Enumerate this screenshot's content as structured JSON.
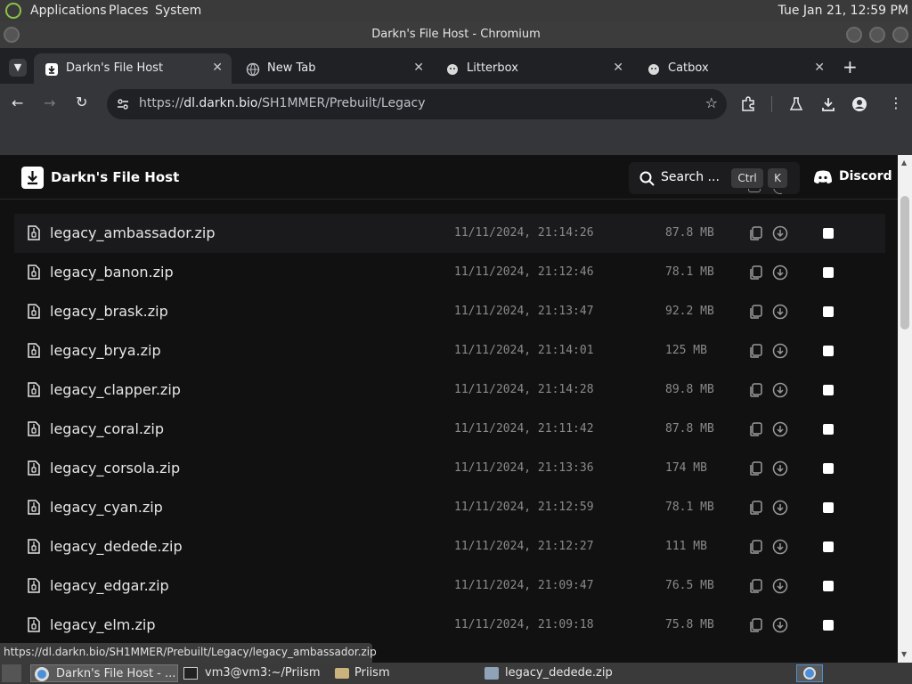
{
  "system_panel": {
    "menus": [
      "Applications",
      "Places",
      "System"
    ],
    "clock": "Tue Jan 21, 12:59 PM"
  },
  "window": {
    "title": "Darkn's File Host - Chromium"
  },
  "tabs": [
    {
      "label": "Darkn's File Host",
      "active": true
    },
    {
      "label": "New Tab",
      "active": false
    },
    {
      "label": "Litterbox",
      "active": false
    },
    {
      "label": "Catbox",
      "active": false
    }
  ],
  "toolbar": {
    "url_scheme": "https://",
    "url_host": "dl.darkn.bio",
    "url_path": "/SH1MMER/Prebuilt/Legacy"
  },
  "site": {
    "title": "Darkn's File Host",
    "search_label": "Search ...",
    "kbd_ctrl": "Ctrl",
    "kbd_k": "K",
    "discord_label": "Discord"
  },
  "files": [
    {
      "name": "legacy_ambassador.zip",
      "date": "11/11/2024, 21:14:26",
      "size": "87.8 MB"
    },
    {
      "name": "legacy_banon.zip",
      "date": "11/11/2024, 21:12:46",
      "size": "78.1 MB"
    },
    {
      "name": "legacy_brask.zip",
      "date": "11/11/2024, 21:13:47",
      "size": "92.2 MB"
    },
    {
      "name": "legacy_brya.zip",
      "date": "11/11/2024, 21:14:01",
      "size": "125 MB"
    },
    {
      "name": "legacy_clapper.zip",
      "date": "11/11/2024, 21:14:28",
      "size": "89.8 MB"
    },
    {
      "name": "legacy_coral.zip",
      "date": "11/11/2024, 21:11:42",
      "size": "87.8 MB"
    },
    {
      "name": "legacy_corsola.zip",
      "date": "11/11/2024, 21:13:36",
      "size": "174 MB"
    },
    {
      "name": "legacy_cyan.zip",
      "date": "11/11/2024, 21:12:59",
      "size": "78.1 MB"
    },
    {
      "name": "legacy_dedede.zip",
      "date": "11/11/2024, 21:12:27",
      "size": "111 MB"
    },
    {
      "name": "legacy_edgar.zip",
      "date": "11/11/2024, 21:09:47",
      "size": "76.5 MB"
    },
    {
      "name": "legacy_elm.zip",
      "date": "11/11/2024, 21:09:18",
      "size": "75.8 MB"
    }
  ],
  "status_url": "https://dl.darkn.bio/SH1MMER/Prebuilt/Legacy/legacy_ambassador.zip",
  "taskbar": {
    "items": [
      "Darkn's File Host - ...",
      "vm3@vm3:~/Priism",
      "Priism",
      "legacy_dedede.zip"
    ]
  }
}
